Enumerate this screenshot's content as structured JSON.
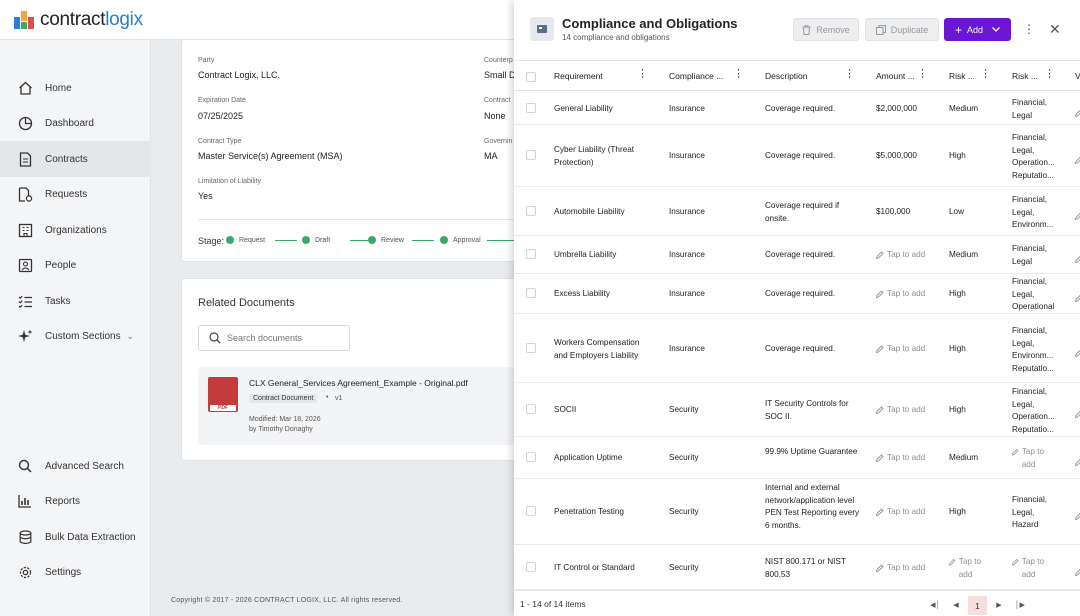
{
  "app": {
    "brand_prefix": "contract",
    "brand_suffix": "logix"
  },
  "sidebar": {
    "items": [
      {
        "label": "Home",
        "icon": "home-icon"
      },
      {
        "label": "Dashboard",
        "icon": "dashboard-icon"
      },
      {
        "label": "Contracts",
        "icon": "contracts-icon",
        "active": true
      },
      {
        "label": "Requests",
        "icon": "requests-icon"
      },
      {
        "label": "Organizations",
        "icon": "organizations-icon"
      },
      {
        "label": "People",
        "icon": "people-icon"
      },
      {
        "label": "Tasks",
        "icon": "tasks-icon"
      },
      {
        "label": "Custom Sections",
        "icon": "sparkle-icon"
      }
    ],
    "bottom_items": [
      {
        "label": "Advanced Search",
        "icon": "search-icon"
      },
      {
        "label": "Reports",
        "icon": "reports-icon"
      },
      {
        "label": "Bulk Data Extraction",
        "icon": "database-icon"
      },
      {
        "label": "Settings",
        "icon": "gear-icon"
      }
    ]
  },
  "contract": {
    "party_label": "Party",
    "party_value": "Contract Logix, LLC.",
    "counterparty_label": "Counterp",
    "counterparty_value": "Small Da",
    "expiration_label": "Expiration Date",
    "expiration_value": "07/25/2025",
    "contract_label": "Contract",
    "contract_value": "None",
    "type_label": "Contract Type",
    "type_value": "Master Service(s) Agreement (MSA)",
    "governing_label": "Governin",
    "governing_value": "MA",
    "limitation_label": "Limitation of Liability",
    "limitation_value": "Yes",
    "stage_label": "Stage:",
    "stages": [
      "Request",
      "Draft",
      "Review",
      "Approval"
    ]
  },
  "related": {
    "title": "Related Documents",
    "search_placeholder": "Search documents",
    "doc_name": "CLX General_Services Agreement_Example - Original.pdf",
    "doc_type": "Contract Document",
    "doc_version": "v1",
    "doc_modified": "Modified: Mar 18, 2026",
    "doc_by": "by Timothy Donaghy",
    "pdf_badge": "PDF"
  },
  "footer": {
    "copyright": "Copyright © 2017 - 2026 CONTRACT LOGIX, LLC. All rights reserved."
  },
  "panel": {
    "title": "Compliance and Obligations",
    "subtitle": "14 compliance and obligations",
    "remove_label": "Remove",
    "duplicate_label": "Duplicate",
    "add_label": "Add",
    "columns": [
      "Requirement",
      "Compliance ...",
      "Description",
      "Amount ...",
      "Risk ...",
      "Risk ...",
      "V"
    ],
    "tap_label": "Tap to add",
    "rows": [
      {
        "req": "General Liability",
        "comp": "Insurance",
        "desc": "Coverage required.",
        "amount": "$2,000,000",
        "risk": "Medium",
        "cat": "Financial, Legal"
      },
      {
        "req": "Cyber Liability (Threat Protection)",
        "comp": "Insurance",
        "desc": "Coverage required.",
        "amount": "$5,000,000",
        "risk": "High",
        "cat": "Financial, Legal, Operation... Reputatio..."
      },
      {
        "req": "Automobile Liability",
        "comp": "Insurance",
        "desc": "Coverage required if onsite.",
        "amount": "$100,000",
        "risk": "Low",
        "cat": "Financial, Legal, Environm..."
      },
      {
        "req": "Umbrella Liability",
        "comp": "Insurance",
        "desc": "Coverage required.",
        "amount": "",
        "risk": "Medium",
        "cat": "Financial, Legal"
      },
      {
        "req": "Excess Liability",
        "comp": "Insurance",
        "desc": "Coverage required.",
        "amount": "",
        "risk": "High",
        "cat": "Financial, Legal, Operational"
      },
      {
        "req": "Workers Compensation and Employers Liability",
        "comp": "Insurance",
        "desc": "Coverage required.",
        "amount": "",
        "risk": "High",
        "cat": "Financial, Legal, Environm... Reputatio..."
      },
      {
        "req": "SOCII",
        "comp": "Security",
        "desc": "IT Security Controls for SOC II.",
        "amount": "",
        "risk": "High",
        "cat": "Financial, Legal, Operation... Reputatio..."
      },
      {
        "req": "Application Uptime",
        "comp": "Security",
        "desc": "99.9% Uptime Guarantee",
        "amount": "",
        "risk": "Medium",
        "cat": ""
      },
      {
        "req": "Penetration Testing",
        "comp": "Security",
        "desc": "Internal and external network/application level PEN Test Reporting every 6 months.",
        "amount": "",
        "risk": "High",
        "cat": "Financial, Legal, Hazard"
      },
      {
        "req": "IT Control or Standard",
        "comp": "Security",
        "desc": "NIST 800.171 or NIST 800.53",
        "amount": "",
        "risk": "",
        "cat": ""
      }
    ],
    "pagination_text": "1 - 14 of 14 items",
    "current_page": "1"
  },
  "colors": {
    "accent": "#6a16d4",
    "stage": "#3aa76d",
    "pdf": "#c53b3b"
  }
}
